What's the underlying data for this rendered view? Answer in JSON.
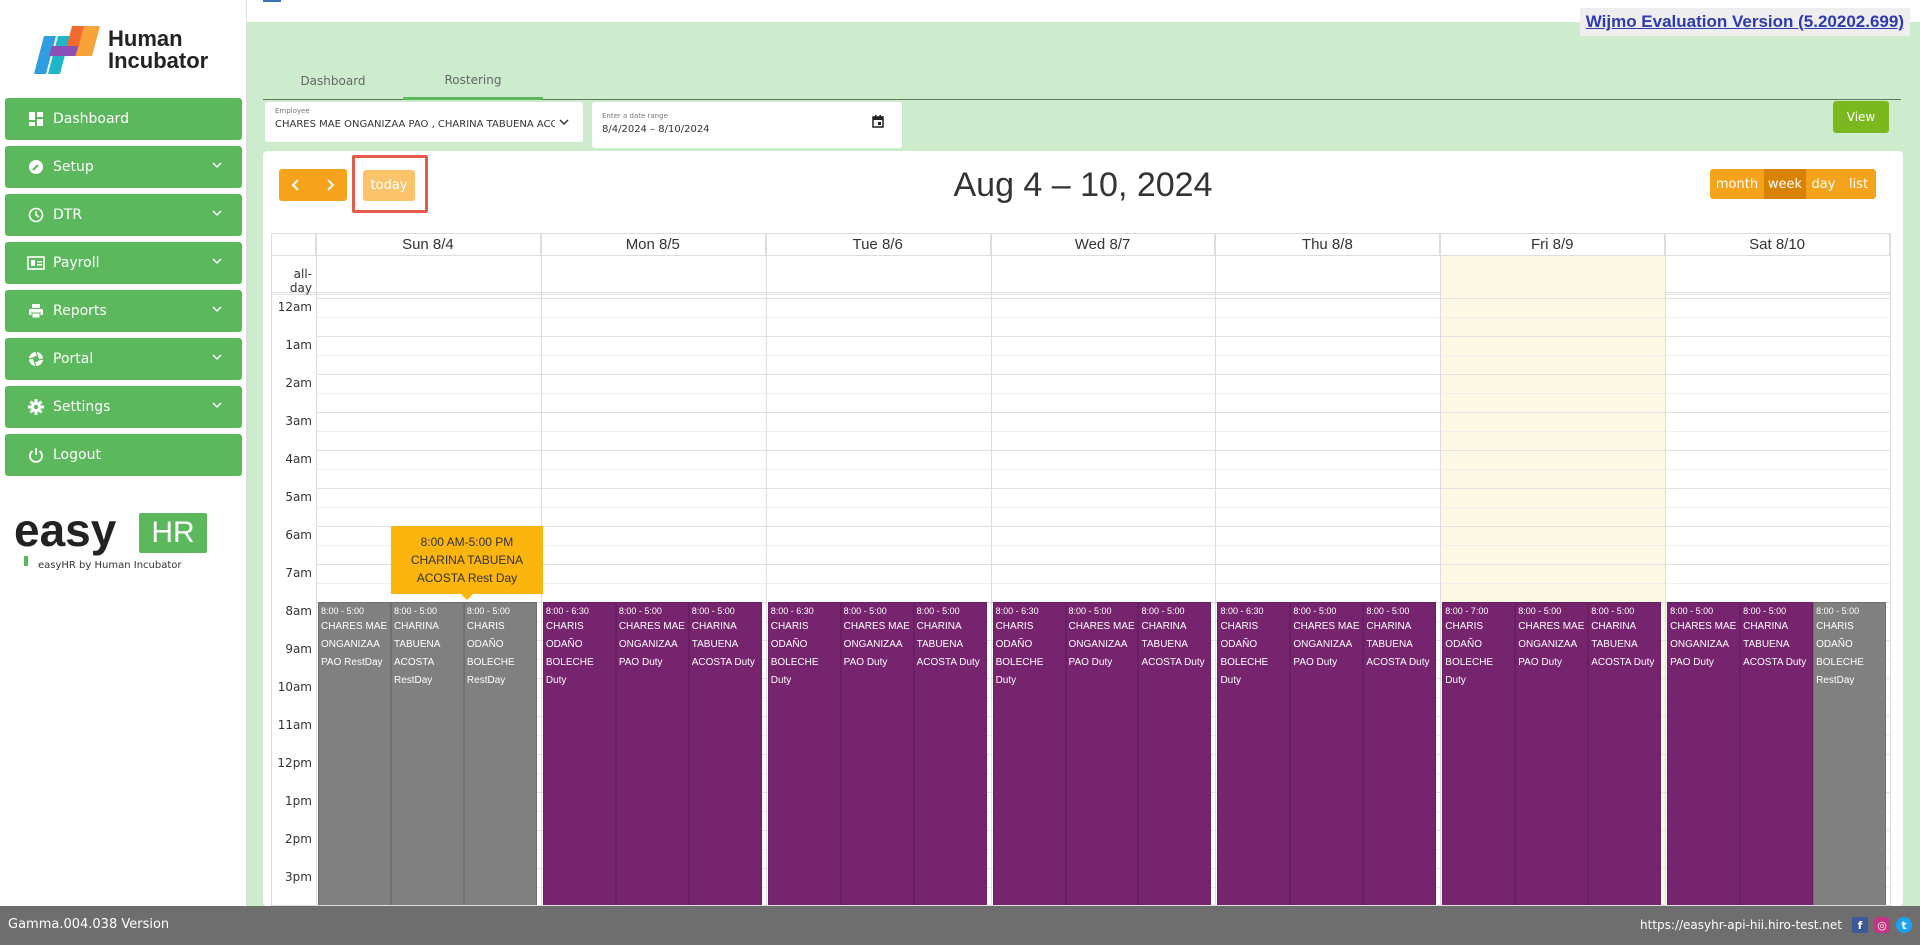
{
  "brand": {
    "logo_line1": "Human",
    "logo_line2": "Incubator",
    "easy": "easy",
    "hr": "HR",
    "tagline": "easyHR by Human Incubator"
  },
  "sidebar": {
    "items": [
      {
        "label": "Dashboard",
        "icon": "dashboard-icon",
        "has_chevron": false
      },
      {
        "label": "Setup",
        "icon": "wrench-icon",
        "has_chevron": true
      },
      {
        "label": "DTR",
        "icon": "clock-icon",
        "has_chevron": true
      },
      {
        "label": "Payroll",
        "icon": "payroll-icon",
        "has_chevron": true
      },
      {
        "label": "Reports",
        "icon": "printer-icon",
        "has_chevron": true
      },
      {
        "label": "Portal",
        "icon": "aperture-icon",
        "has_chevron": true
      },
      {
        "label": "Settings",
        "icon": "gear-icon",
        "has_chevron": true
      },
      {
        "label": "Logout",
        "icon": "power-icon",
        "has_chevron": false
      }
    ]
  },
  "wijmo": {
    "text": "Wijmo Evaluation Version (5.20202.699)"
  },
  "tabs": [
    {
      "label": "Dashboard",
      "active": false
    },
    {
      "label": "Rostering",
      "active": true
    }
  ],
  "filters": {
    "employee_label": "Employee",
    "employee_value": "CHARES MAE ONGANIZAA PAO , CHARINA TABUENA ACOSTA",
    "date_label": "Enter a date range",
    "date_value": "8/4/2024 – 8/10/2024",
    "view_button": "View"
  },
  "calendar": {
    "title": "Aug 4 – 10, 2024",
    "today_label": "today",
    "views": [
      {
        "label": "month",
        "active": false
      },
      {
        "label": "week",
        "active": true
      },
      {
        "label": "day",
        "active": false
      },
      {
        "label": "list",
        "active": false
      }
    ],
    "allday_label": "all-day",
    "days": [
      "Sun 8/4",
      "Mon 8/5",
      "Tue 8/6",
      "Wed 8/7",
      "Thu 8/8",
      "Fri 8/9",
      "Sat 8/10"
    ],
    "today_index": 5,
    "hours": [
      "12am",
      "1am",
      "2am",
      "3am",
      "4am",
      "5am",
      "6am",
      "7am",
      "8am",
      "9am",
      "10am",
      "11am",
      "12pm",
      "1pm",
      "2pm",
      "3pm"
    ],
    "events": [
      {
        "day": 0,
        "slot": 0,
        "time": "8:00 - 5:00",
        "title": "CHARES MAE ONGANIZAA PAO RestDay",
        "type": "rest"
      },
      {
        "day": 0,
        "slot": 1,
        "time": "8:00 - 5:00",
        "title": "CHARINA TABUENA ACOSTA RestDay",
        "type": "rest"
      },
      {
        "day": 0,
        "slot": 2,
        "time": "8:00 - 5:00",
        "title": "CHARIS ODAÑO BOLECHE RestDay",
        "type": "rest"
      },
      {
        "day": 1,
        "slot": 0,
        "time": "8:00 - 6:30",
        "title": "CHARIS ODAÑO BOLECHE Duty",
        "type": "duty"
      },
      {
        "day": 1,
        "slot": 1,
        "time": "8:00 - 5:00",
        "title": "CHARES MAE ONGANIZAA PAO Duty",
        "type": "duty"
      },
      {
        "day": 1,
        "slot": 2,
        "time": "8:00 - 5:00",
        "title": "CHARINA TABUENA ACOSTA Duty",
        "type": "duty"
      },
      {
        "day": 2,
        "slot": 0,
        "time": "8:00 - 6:30",
        "title": "CHARIS ODAÑO BOLECHE Duty",
        "type": "duty"
      },
      {
        "day": 2,
        "slot": 1,
        "time": "8:00 - 5:00",
        "title": "CHARES MAE ONGANIZAA PAO Duty",
        "type": "duty"
      },
      {
        "day": 2,
        "slot": 2,
        "time": "8:00 - 5:00",
        "title": "CHARINA TABUENA ACOSTA Duty",
        "type": "duty"
      },
      {
        "day": 3,
        "slot": 0,
        "time": "8:00 - 6:30",
        "title": "CHARIS ODAÑO BOLECHE Duty",
        "type": "duty"
      },
      {
        "day": 3,
        "slot": 1,
        "time": "8:00 - 5:00",
        "title": "CHARES MAE ONGANIZAA PAO Duty",
        "type": "duty"
      },
      {
        "day": 3,
        "slot": 2,
        "time": "8:00 - 5:00",
        "title": "CHARINA TABUENA ACOSTA Duty",
        "type": "duty"
      },
      {
        "day": 4,
        "slot": 0,
        "time": "8:00 - 6:30",
        "title": "CHARIS ODAÑO BOLECHE Duty",
        "type": "duty"
      },
      {
        "day": 4,
        "slot": 1,
        "time": "8:00 - 5:00",
        "title": "CHARES MAE ONGANIZAA PAO Duty",
        "type": "duty"
      },
      {
        "day": 4,
        "slot": 2,
        "time": "8:00 - 5:00",
        "title": "CHARINA TABUENA ACOSTA Duty",
        "type": "duty"
      },
      {
        "day": 5,
        "slot": 0,
        "time": "8:00 - 7:00",
        "title": "CHARIS ODAÑO BOLECHE Duty",
        "type": "duty"
      },
      {
        "day": 5,
        "slot": 1,
        "time": "8:00 - 5:00",
        "title": "CHARES MAE ONGANIZAA PAO Duty",
        "type": "duty"
      },
      {
        "day": 5,
        "slot": 2,
        "time": "8:00 - 5:00",
        "title": "CHARINA TABUENA ACOSTA Duty",
        "type": "duty"
      },
      {
        "day": 6,
        "slot": 0,
        "time": "8:00 - 5:00",
        "title": "CHARES MAE ONGANIZAA PAO Duty",
        "type": "duty"
      },
      {
        "day": 6,
        "slot": 1,
        "time": "8:00 - 5:00",
        "title": "CHARINA TABUENA ACOSTA Duty",
        "type": "duty"
      },
      {
        "day": 6,
        "slot": 2,
        "time": "8:00 - 5:00",
        "title": "CHARIS ODAÑO BOLECHE RestDay",
        "type": "rest"
      }
    ],
    "tooltip": {
      "line1": "8:00 AM-5:00 PM",
      "line2": "CHARINA TABUENA",
      "line3": "ACOSTA Rest Day"
    }
  },
  "footer": {
    "version": "Gamma.004.038 Version",
    "url": "https://easyhr-api-hii.hiro-test.net"
  },
  "colors": {
    "menu_green": "#5cb85c",
    "duty": "#76246e",
    "rest": "#808080",
    "toolbar": "#f7a21b",
    "today_col": "#fcf8e3",
    "tooltip": "#fbb50d"
  }
}
